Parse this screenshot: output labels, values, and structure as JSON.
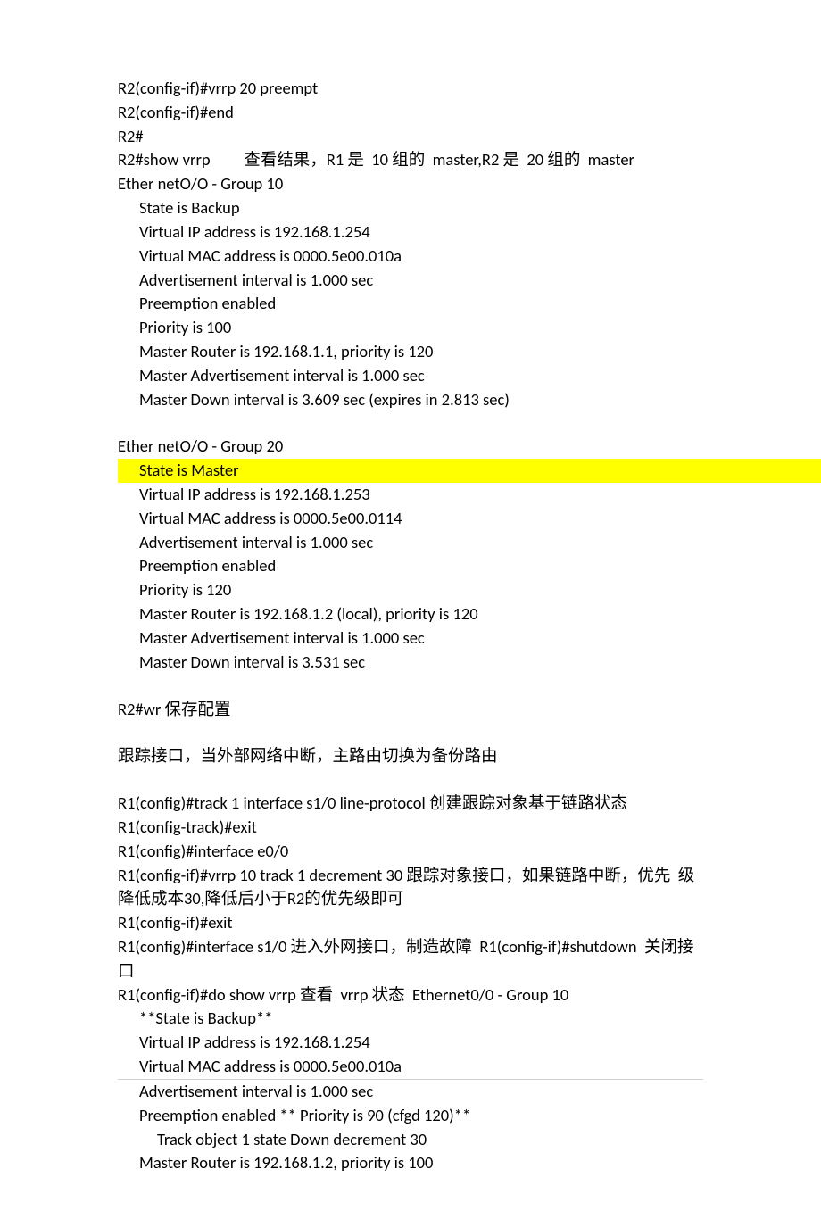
{
  "lines": [
    {
      "t": "R2(config-if)#vrrp 20 preempt"
    },
    {
      "t": "R2(config-if)#end"
    },
    {
      "t": "R2#"
    },
    {
      "t": "R2#show vrrp         查看结果，R1 是  10 组的  master,R2 是  20 组的  master"
    },
    {
      "t": "Ether netO/O - Group 10"
    },
    {
      "t": "State is Backup",
      "c": "ind"
    },
    {
      "t": "Virtual IP address is 192.168.1.254",
      "c": "ind"
    },
    {
      "t": "Virtual MAC address is 0000.5e00.010a",
      "c": "ind"
    },
    {
      "t": "Advertisement interval is 1.000 sec",
      "c": "ind"
    },
    {
      "t": "Preemption enabled",
      "c": "ind"
    },
    {
      "t": "Priority is 100",
      "c": "ind"
    },
    {
      "t": "Master Router is 192.168.1.1, priority is 120",
      "c": "ind"
    },
    {
      "t": "Master Advertisement interval is 1.000 sec",
      "c": "ind"
    },
    {
      "t": "Master Down interval is 3.609 sec (expires in 2.813 sec)",
      "c": "ind"
    },
    {
      "gap": true
    },
    {
      "t": "Ether netO/O - Group 20"
    },
    {
      "t": "State is Master",
      "c": "hl"
    },
    {
      "t": "Virtual IP address is 192.168.1.253",
      "c": "ind"
    },
    {
      "t": "Virtual MAC address is 0000.5e00.0114",
      "c": "ind"
    },
    {
      "t": "Advertisement interval is 1.000 sec",
      "c": "ind"
    },
    {
      "t": "Preemption enabled",
      "c": "ind"
    },
    {
      "t": "Priority is 120",
      "c": "ind"
    },
    {
      "t": "Master Router is 192.168.1.2 (local), priority is 120",
      "c": "ind"
    },
    {
      "t": "Master Advertisement interval is 1.000 sec",
      "c": "ind"
    },
    {
      "t": "Master Down interval is 3.531 sec",
      "c": "ind"
    },
    {
      "gap": true
    },
    {
      "t": "R2#wr 保存配置"
    },
    {
      "gap": true
    },
    {
      "t": "跟踪接口，当外部网络中断，主路由切换为备份路由"
    },
    {
      "gap": true
    },
    {
      "t": "R1(config)#track 1 interface s1/0 line-protocol 创建跟踪对象基于链路状态"
    },
    {
      "t": "R1(config-track)#exit"
    },
    {
      "t": "R1(config)#interface e0/0"
    },
    {
      "t": "R1(config-if)#vrrp 10 track 1 decrement 30 跟踪对象接口，如果链路中断，优先  级降低成本30,降低后小于R2的优先级即可"
    },
    {
      "t": "R1(config-if)#exit"
    },
    {
      "t": "R1(config)#interface s1/0 进入外网接口，制造故障  R1(config-if)#shutdown  关闭接口"
    },
    {
      "t": "R1(config-if)#do show vrrp 查看  vrrp 状态  Ethernet0/0 - Group 10"
    },
    {
      "t": "**State is Backup**",
      "c": "ind"
    },
    {
      "t": "Virtual IP address is 192.168.1.254",
      "c": "ind"
    },
    {
      "t": "Virtual MAC address is 0000.5e00.010a",
      "c": "ind"
    },
    {
      "hr": true
    },
    {
      "t": "Advertisement interval is 1.000 sec",
      "c": "ind"
    },
    {
      "t": "Preemption enabled ** Priority is 90 (cfgd 120)**",
      "c": "ind"
    },
    {
      "t": "Track object 1 state Down decrement 30",
      "c": "ind2"
    },
    {
      "t": "Master Router is 192.168.1.2, priority is 100",
      "c": "ind"
    }
  ]
}
